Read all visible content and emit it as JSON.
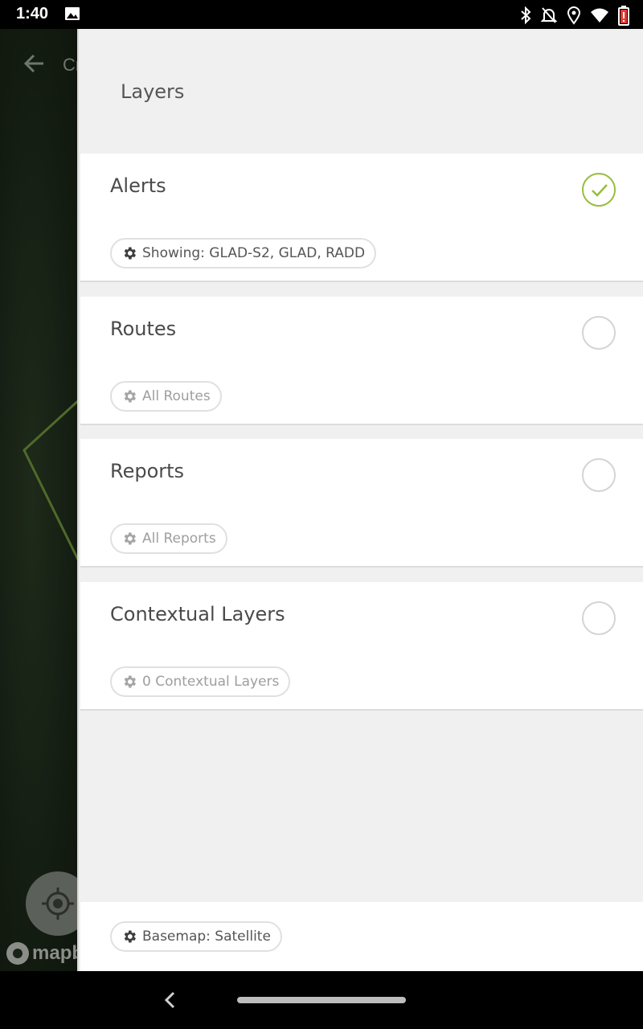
{
  "status_bar": {
    "time": "1:40",
    "left_icons": [
      "image-icon"
    ],
    "right_icons": [
      "bluetooth-icon",
      "notifications-off-icon",
      "location-icon",
      "wifi-icon",
      "battery-icon"
    ]
  },
  "map": {
    "title_fragment": "Cr",
    "attribution": "mapb"
  },
  "drawer": {
    "title": "Layers",
    "layers": [
      {
        "name": "Alerts",
        "enabled": true,
        "chip": "Showing: GLAD-S2, GLAD, RADD"
      },
      {
        "name": "Routes",
        "enabled": false,
        "chip": "All Routes"
      },
      {
        "name": "Reports",
        "enabled": false,
        "chip": "All Reports"
      },
      {
        "name": "Contextual Layers",
        "enabled": false,
        "chip": "0 Contextual Layers"
      }
    ],
    "basemap_chip": "Basemap: Satellite"
  },
  "colors": {
    "accent_green": "#97bd3d",
    "drawer_bg": "#f0f0f0",
    "card_bg": "#ffffff"
  }
}
